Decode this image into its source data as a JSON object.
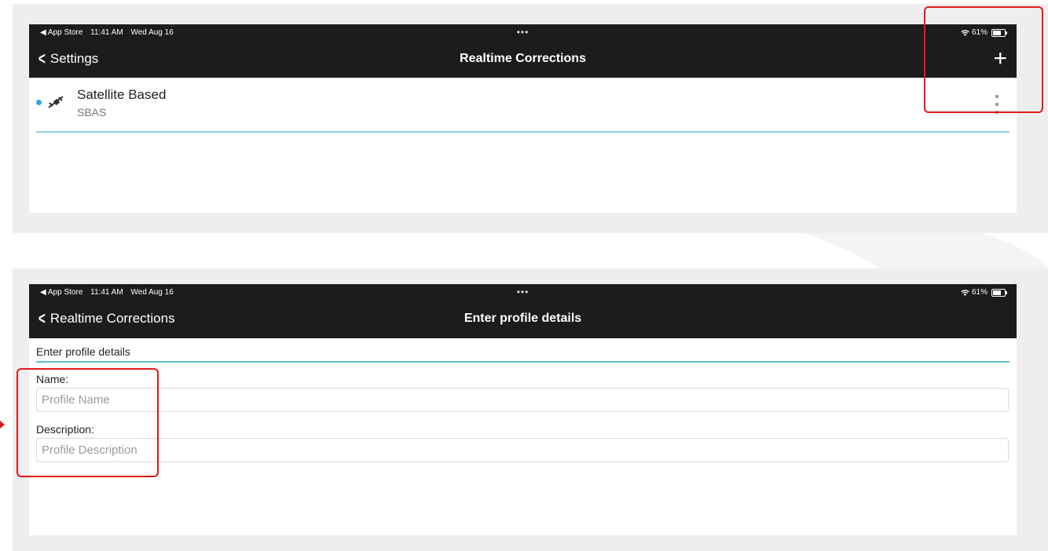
{
  "colors": {
    "bar_bg": "#1c1c1e",
    "panel_bg": "#eeeeee",
    "accent_blue": "#2ea6e0",
    "divider_blue": "#5bbbd8",
    "highlight_red": "#e01919"
  },
  "screen1": {
    "status": {
      "back_app": "◀ App Store",
      "time": "11:41 AM",
      "date": "Wed Aug 16",
      "dots": "•••",
      "battery": "61%"
    },
    "nav": {
      "back_label": "Settings",
      "title": "Realtime Corrections",
      "add_label": "+"
    },
    "list": [
      {
        "title": "Satellite Based",
        "subtitle": "SBAS",
        "icon": "satellite-icon",
        "active": true
      }
    ]
  },
  "screen2": {
    "status": {
      "back_app": "◀ App Store",
      "time": "11:41 AM",
      "date": "Wed Aug 16",
      "dots": "•••",
      "battery": "61%"
    },
    "nav": {
      "back_label": "Realtime Corrections",
      "title": "Enter profile details"
    },
    "form": {
      "header": "Enter profile details",
      "name_label": "Name:",
      "name_placeholder": "Profile Name",
      "name_value": "",
      "description_label": "Description:",
      "description_placeholder": "Profile Description",
      "description_value": ""
    }
  }
}
